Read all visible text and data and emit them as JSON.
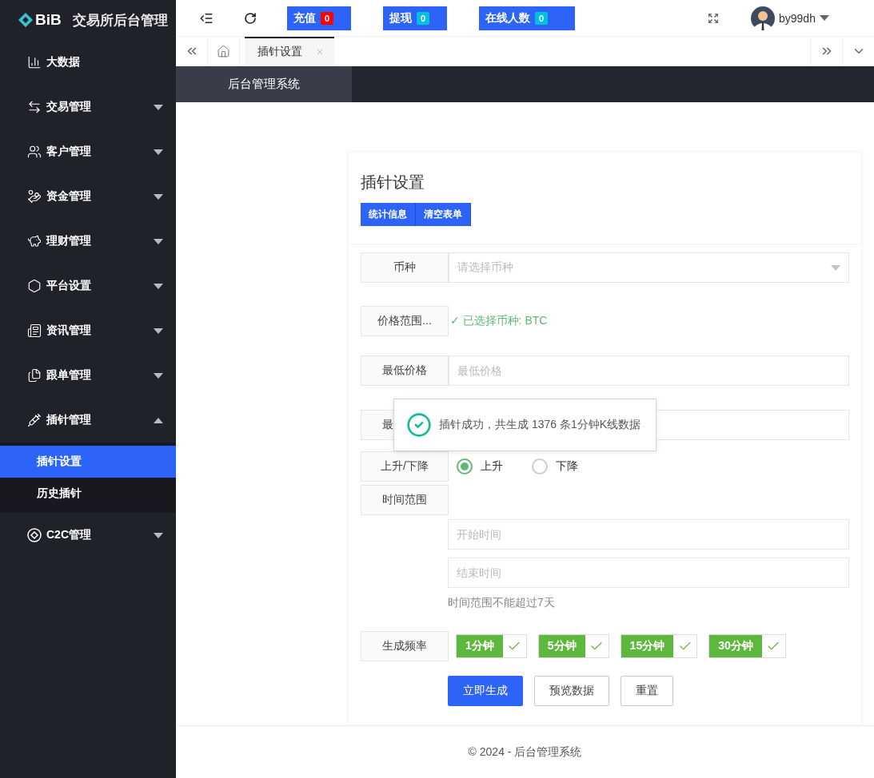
{
  "logo": {
    "brand": "BiB",
    "title": "交易所后台管理"
  },
  "header": {
    "stats": [
      {
        "label": "充值",
        "count": "0",
        "color": "#ff0000"
      },
      {
        "label": "提现",
        "count": "0",
        "color": "#00c1de"
      },
      {
        "label": "在线人数",
        "count": "0",
        "color": "#00c1de"
      }
    ],
    "user": "by99dh"
  },
  "sidebar": {
    "items": [
      {
        "label": "大数据"
      },
      {
        "label": "交易管理",
        "expanded": false
      },
      {
        "label": "客户管理",
        "expanded": false
      },
      {
        "label": "资金管理",
        "expanded": false
      },
      {
        "label": "理财管理",
        "expanded": false
      },
      {
        "label": "平台设置",
        "expanded": false
      },
      {
        "label": "资讯管理",
        "expanded": false
      },
      {
        "label": "跟单管理",
        "expanded": false
      },
      {
        "label": "插针管理",
        "expanded": true,
        "children": [
          {
            "label": "插针设置",
            "selected": true
          },
          {
            "label": "历史插针",
            "selected": false
          }
        ]
      },
      {
        "label": "C2C管理",
        "expanded": false
      }
    ]
  },
  "tabs": [
    {
      "label": "插针设置",
      "selected": true
    }
  ],
  "section_tab": "后台管理系统",
  "card": {
    "title": "插针设置",
    "actions": [
      "统计信息",
      "清空表单"
    ]
  },
  "form": {
    "coin": {
      "label": "币种",
      "placeholder": "请选择币种"
    },
    "price_range": {
      "label": "价格范围...",
      "note": "✓ 已选择币种: BTC"
    },
    "low": {
      "label": "最低价格",
      "placeholder": "最低价格"
    },
    "high": {
      "label": "最"
    },
    "direction": {
      "label": "上升/下降",
      "options": [
        {
          "label": "上升",
          "selected": true
        },
        {
          "label": "下降",
          "selected": false
        }
      ]
    },
    "time": {
      "label": "时间范围",
      "start_placeholder": "开始时间",
      "end_placeholder": "结束时间",
      "hint": "时间范围不能超过7天"
    },
    "frequency": {
      "label": "生成频率",
      "options": [
        {
          "label": "1分钟",
          "checked": true
        },
        {
          "label": "5分钟",
          "checked": true
        },
        {
          "label": "15分钟",
          "checked": true
        },
        {
          "label": "30分钟",
          "checked": true
        }
      ]
    },
    "buttons": [
      {
        "label": "立即生成",
        "kind": "primary"
      },
      {
        "label": "预览数据",
        "kind": "default"
      },
      {
        "label": "重置",
        "kind": "default"
      }
    ]
  },
  "toast": {
    "message": "插针成功，共生成 1376 条1分钟K线数据"
  },
  "footer": "© 2024 - 后台管理系统"
}
